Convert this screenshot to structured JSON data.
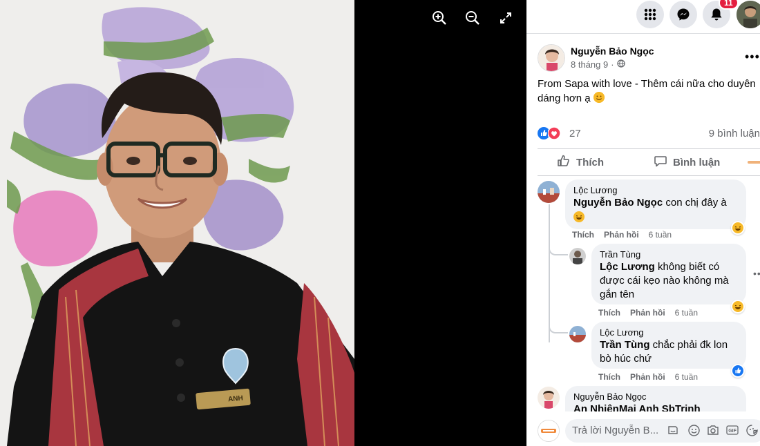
{
  "viewer": {
    "tools": [
      {
        "icon": "zoom-in-icon"
      },
      {
        "icon": "zoom-out-icon"
      },
      {
        "icon": "fullscreen-icon"
      }
    ],
    "badge_text": "ANH"
  },
  "nav": {
    "notification_count": "11",
    "icons": [
      "menu-grid-icon",
      "messenger-icon",
      "bell-icon"
    ]
  },
  "post": {
    "author": "Nguyễn Bảo Ngọc",
    "date": "8 tháng 9",
    "separator": "·",
    "text": "From Sapa with love - Thêm cái nữa cho duyên dáng hơn ạ",
    "reaction_count": "27",
    "comment_count": "9 bình luận",
    "like_label": "Thích",
    "comment_label": "Bình luận"
  },
  "comments": [
    {
      "author": "Lộc Lương",
      "mention": "Nguyễn Bảo Ngọc",
      "text": " con chị đây à",
      "like": "Thích",
      "reply": "Phản hồi",
      "time": "6 tuần",
      "reaction": "haha"
    },
    {
      "author": "Trần Tùng",
      "mention": "Lộc Lương",
      "text": " không biết có được cái kẹo nào không mà gắn tên",
      "like": "Thích",
      "reply": "Phản hồi",
      "time": "6 tuần",
      "reaction": "haha"
    },
    {
      "author": "Lộc Lương",
      "mention": "Trần Tùng",
      "text": " chắc phải đk lon bò húc chứ",
      "like": "Thích",
      "reply": "Phản hồi",
      "time": "6 tuần",
      "reaction": "like"
    },
    {
      "author": "Nguyễn Bảo Ngọc",
      "mention": "An NhiênMai Anh SbTrinh",
      "text": ""
    }
  ],
  "composer": {
    "placeholder": "Trả lời Nguyễn B...",
    "icons": [
      "sticker-icon",
      "emoji-icon",
      "camera-icon",
      "gif-icon",
      "sticker-smile-icon"
    ]
  },
  "colors": {
    "accent": "#1877f2",
    "badge": "#e41e3f",
    "reaction_yellow": "#f7b928",
    "love": "#f33e58"
  }
}
